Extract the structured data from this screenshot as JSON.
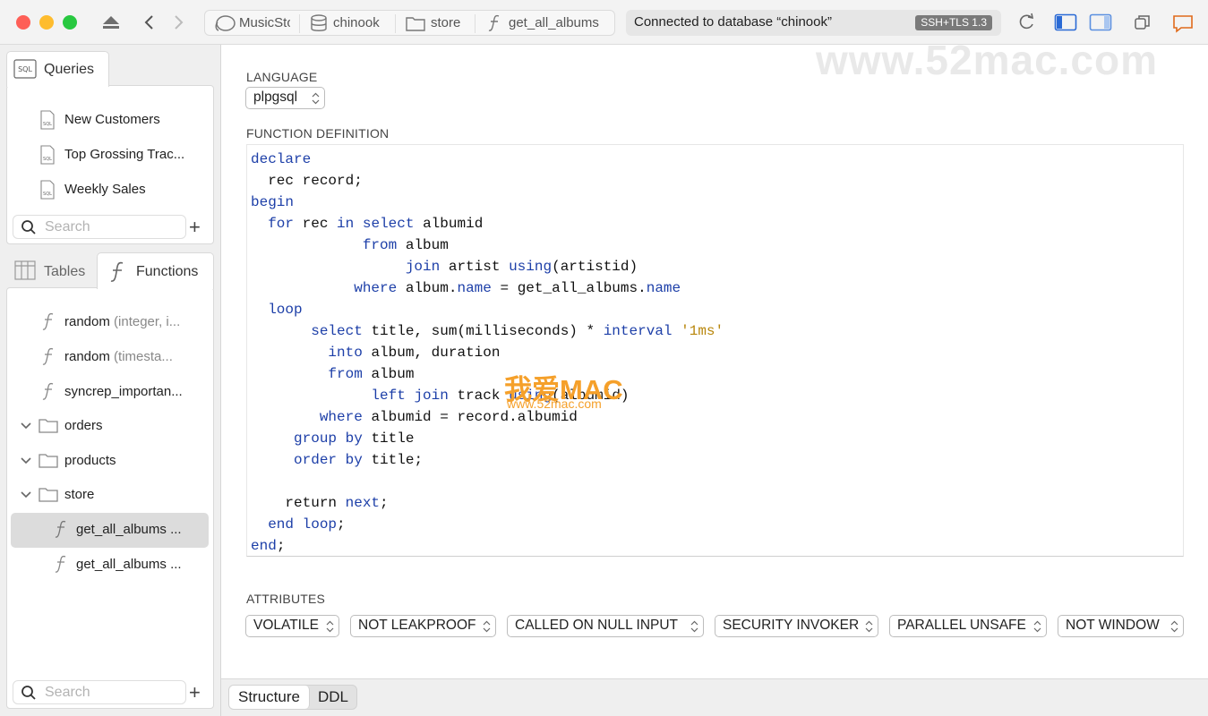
{
  "window": {
    "breadcrumb": [
      {
        "label": "MusicSto",
        "icon": "elephant-icon"
      },
      {
        "label": "chinook",
        "icon": "database-icon"
      },
      {
        "label": "store",
        "icon": "folder-icon"
      },
      {
        "label": "get_all_albums",
        "icon": "function-icon"
      }
    ],
    "status_text": "Connected to database “chinook”",
    "status_badge": "SSH+TLS 1.3"
  },
  "sidebar": {
    "queries_tab": "Queries",
    "queries": [
      "New Customers",
      "Top Grossing Trac...",
      "Weekly Sales"
    ],
    "search_placeholder": "Search",
    "tables_tab": "Tables",
    "functions_tab": "Functions",
    "tree": [
      {
        "label": "random",
        "detail": "(integer, i...",
        "type": "function"
      },
      {
        "label": "random",
        "detail": "(timesta...",
        "type": "function"
      },
      {
        "label": "syncrep_importan...",
        "detail": "",
        "type": "function"
      },
      {
        "label": "orders",
        "type": "folder"
      },
      {
        "label": "products",
        "type": "folder"
      },
      {
        "label": "store",
        "type": "folder"
      },
      {
        "label": "get_all_albums ...",
        "type": "function",
        "selected": true
      },
      {
        "label": "get_all_albums ...",
        "type": "function"
      }
    ],
    "bottom_search_placeholder": "Search"
  },
  "main": {
    "language_label": "LANGUAGE",
    "language_value": "plpgsql",
    "definition_label": "FUNCTION DEFINITION",
    "code_lines": [
      "declare",
      "  rec record;",
      "begin",
      "  for rec in select albumid",
      "             from album",
      "                  join artist using(artistid)",
      "            where album.name = get_all_albums.name",
      "  loop",
      "       select title, sum(milliseconds) * interval '1ms'",
      "         into album, duration",
      "         from album",
      "              left join track using(albumid)",
      "        where albumid = record.albumid",
      "     group by title",
      "     order by title;",
      "",
      "    return next;",
      "  end loop;",
      "end;"
    ],
    "attributes_label": "ATTRIBUTES",
    "attributes": [
      "VOLATILE",
      "NOT LEAKPROOF",
      "CALLED ON NULL INPUT",
      "SECURITY INVOKER",
      "PARALLEL UNSAFE",
      "NOT WINDOW"
    ]
  },
  "bottom_tabs": [
    "Structure",
    "DDL"
  ],
  "watermarks": {
    "top": "www.52mac.com",
    "center_main": "我爱MAC",
    "center_sub": "www.52mac.com"
  },
  "colors": {
    "keyword": "#1d3fa8",
    "string": "#b8860b",
    "selection": "#dcdcdc"
  }
}
